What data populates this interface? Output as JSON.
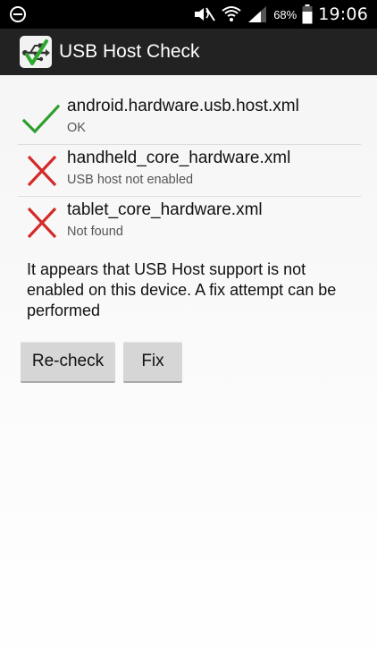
{
  "status_bar": {
    "battery_percent": "68%",
    "time": "19:06",
    "icons": [
      "minus-circle-icon",
      "mute-icon",
      "wifi-icon",
      "signal-icon",
      "battery-icon"
    ]
  },
  "action_bar": {
    "app_icon": "usb-check-app-icon",
    "title": "USB Host Check"
  },
  "checks": [
    {
      "name": "android.hardware.usb.host.xml",
      "status": "OK",
      "result": "pass",
      "color": "#2e9e2e"
    },
    {
      "name": "handheld_core_hardware.xml",
      "status": "USB host not enabled",
      "result": "fail",
      "color": "#d42a2a"
    },
    {
      "name": "tablet_core_hardware.xml",
      "status": "Not found",
      "result": "fail",
      "color": "#d42a2a"
    }
  ],
  "message": "It appears that USB Host support is not enabled on this device. A fix attempt can be performed",
  "buttons": {
    "recheck_label": "Re-check",
    "fix_label": "Fix"
  }
}
